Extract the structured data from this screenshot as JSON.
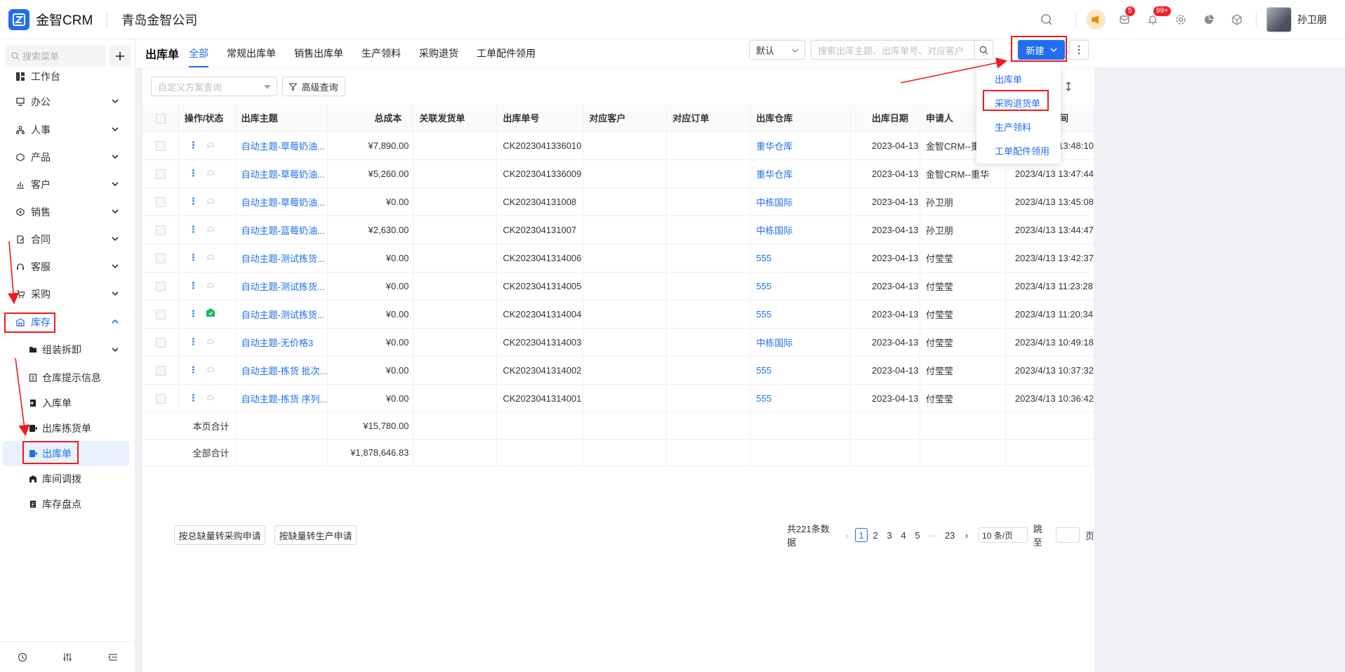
{
  "app": {
    "name": "金智CRM",
    "company": "青岛金智公司"
  },
  "header": {
    "msg_badge": "5",
    "notice_badge": "99+",
    "user_name": "孙卫朋"
  },
  "sidebar": {
    "search_placeholder": "搜索菜单",
    "items": [
      {
        "label": "工作台"
      },
      {
        "label": "办公"
      },
      {
        "label": "人事"
      },
      {
        "label": "产品"
      },
      {
        "label": "客户"
      },
      {
        "label": "销售"
      },
      {
        "label": "合同"
      },
      {
        "label": "客服"
      },
      {
        "label": "采购"
      },
      {
        "label": "库存"
      }
    ],
    "sub_items": [
      {
        "label": "组装拆卸"
      },
      {
        "label": "仓库提示信息"
      },
      {
        "label": "入库单"
      },
      {
        "label": "出库拣货单"
      },
      {
        "label": "出库单"
      },
      {
        "label": "库间调拨"
      },
      {
        "label": "库存盘点"
      }
    ]
  },
  "page": {
    "title": "出库单",
    "tabs": [
      "全部",
      "常规出库单",
      "销售出库单",
      "生产领料",
      "采购退货",
      "工单配件领用"
    ],
    "view_select": "默认",
    "search_placeholder": "搜索出库主题、出库单号、对应客户",
    "new_label": "新建",
    "filter_placeholder": "自定义方案查询",
    "advanced_label": "高级查询"
  },
  "dropdown": {
    "items": [
      "出库单",
      "采购退货单",
      "生产领料",
      "工单配件领用"
    ]
  },
  "table": {
    "headers": [
      "操作/状态",
      "出库主题",
      "总成本",
      "关联发货单",
      "出库单号",
      "对应客户",
      "对应订单",
      "出库仓库",
      "出库日期",
      "申请人",
      "创建时间"
    ],
    "header_last_visible": "间",
    "rows": [
      {
        "subject": "自动主题-草莓奶油...",
        "cost": "¥7,890.00",
        "no": "CK2023041336010",
        "warehouse": "重华仓库",
        "date": "2023-04-13",
        "applicant": "金智CRM--重华",
        "created": "2023/4/13 13:48:10"
      },
      {
        "subject": "自动主题-草莓奶油...",
        "cost": "¥5,260.00",
        "no": "CK2023041336009",
        "warehouse": "重华仓库",
        "date": "2023-04-13",
        "applicant": "金智CRM--重华",
        "created": "2023/4/13 13:47:44"
      },
      {
        "subject": "自动主题-草莓奶油...",
        "cost": "¥0.00",
        "no": "CK202304131008",
        "warehouse": "中栋国际",
        "date": "2023-04-13",
        "applicant": "孙卫朋",
        "created": "2023/4/13 13:45:08"
      },
      {
        "subject": "自动主题-蓝莓奶油...",
        "cost": "¥2,630.00",
        "no": "CK202304131007",
        "warehouse": "中栋国际",
        "date": "2023-04-13",
        "applicant": "孙卫朋",
        "created": "2023/4/13 13:44:47"
      },
      {
        "subject": "自动主题-测试拣货...",
        "cost": "¥0.00",
        "no": "CK2023041314006",
        "warehouse": "555",
        "date": "2023-04-13",
        "applicant": "付莹莹",
        "created": "2023/4/13 13:42:37"
      },
      {
        "subject": "自动主题-测试拣货...",
        "cost": "¥0.00",
        "no": "CK2023041314005",
        "warehouse": "555",
        "date": "2023-04-13",
        "applicant": "付莹莹",
        "created": "2023/4/13 11:23:28"
      },
      {
        "subject": "自动主题-测试拣货...",
        "cost": "¥0.00",
        "no": "CK2023041314004",
        "warehouse": "555",
        "date": "2023-04-13",
        "applicant": "付莹莹",
        "created": "2023/4/13 11:20:34"
      },
      {
        "subject": "自动主题-无价格3",
        "cost": "¥0.00",
        "no": "CK2023041314003",
        "warehouse": "中栋国际",
        "date": "2023-04-13",
        "applicant": "付莹莹",
        "created": "2023/4/13 10:49:18"
      },
      {
        "subject": "自动主题-拣货 批次...",
        "cost": "¥0.00",
        "no": "CK2023041314002",
        "warehouse": "555",
        "date": "2023-04-13",
        "applicant": "付莹莹",
        "created": "2023/4/13 10:37:32"
      },
      {
        "subject": "自动主题-拣货 序列...",
        "cost": "¥0.00",
        "no": "CK2023041314001",
        "warehouse": "555",
        "date": "2023-04-13",
        "applicant": "付莹莹",
        "created": "2023/4/13 10:36:42"
      }
    ],
    "page_total_label": "本页合计",
    "page_total": "¥15,780.00",
    "all_total_label": "全部合计",
    "all_total": "¥1,878,646.83"
  },
  "footer": {
    "btn1": "按总缺量转采购申请",
    "btn2": "按缺量转生产申请",
    "total": "共221条数据",
    "pages": [
      "1",
      "2",
      "3",
      "4",
      "5",
      "···",
      "23"
    ],
    "page_size": "10 条/页",
    "jump_label": "跳至",
    "page_unit": "页"
  },
  "colors": {
    "accent": "#1f6ff0",
    "annotation": "#f21b1b"
  }
}
